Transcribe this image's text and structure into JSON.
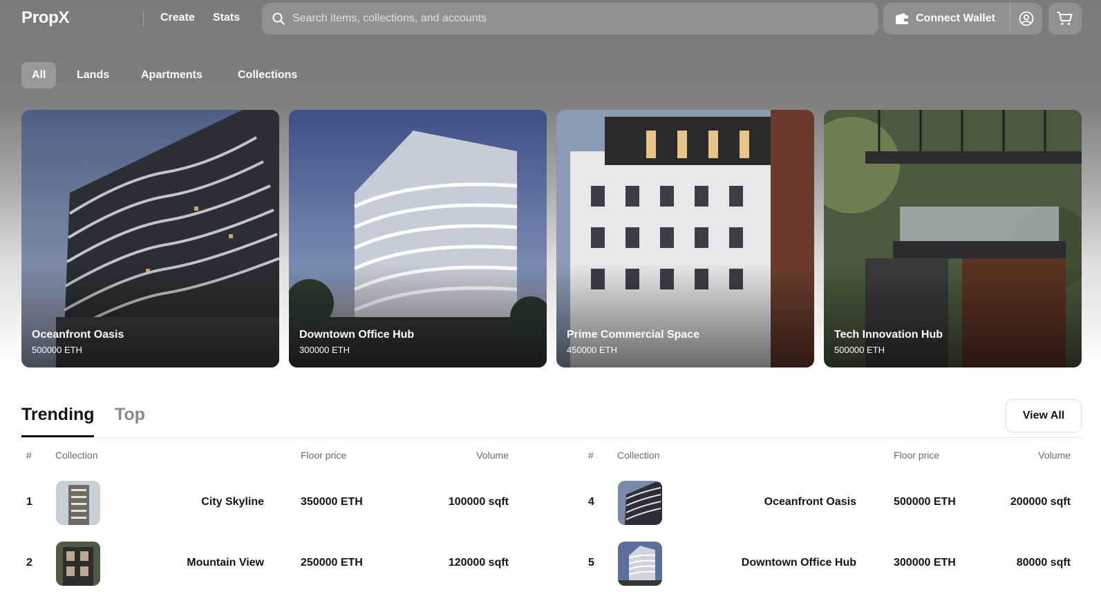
{
  "header": {
    "logo": "PropX",
    "nav": [
      "Create",
      "Stats"
    ],
    "search_placeholder": "Search items, collections, and accounts",
    "wallet_label": "Connect Wallet",
    "icons": [
      "search-icon",
      "wallet-icon",
      "profile-icon",
      "cart-icon"
    ]
  },
  "categories": {
    "items": [
      "All",
      "Lands",
      "Apartments",
      "Collections"
    ],
    "active": "All"
  },
  "featured": [
    {
      "name": "Oceanfront Oasis",
      "price": "500000 ETH"
    },
    {
      "name": "Downtown Office Hub",
      "price": "300000 ETH"
    },
    {
      "name": "Prime Commercial Space",
      "price": "450000 ETH"
    },
    {
      "name": "Tech Innovation Hub",
      "price": "500000 ETH"
    }
  ],
  "ranking": {
    "tabs": [
      "Trending",
      "Top"
    ],
    "active_tab": "Trending",
    "view_all": "View All",
    "columns": {
      "rank": "#",
      "collection": "Collection",
      "floor": "Floor price",
      "volume": "Volume"
    },
    "left": [
      {
        "rank": "1",
        "name": "City Skyline",
        "floor": "350000 ETH",
        "volume": "100000 sqft"
      },
      {
        "rank": "2",
        "name": "Mountain View",
        "floor": "250000 ETH",
        "volume": "120000 sqft"
      }
    ],
    "right": [
      {
        "rank": "4",
        "name": "Oceanfront Oasis",
        "floor": "500000 ETH",
        "volume": "200000 sqft"
      },
      {
        "rank": "5",
        "name": "Downtown Office Hub",
        "floor": "300000 ETH",
        "volume": "80000 sqft"
      }
    ]
  }
}
